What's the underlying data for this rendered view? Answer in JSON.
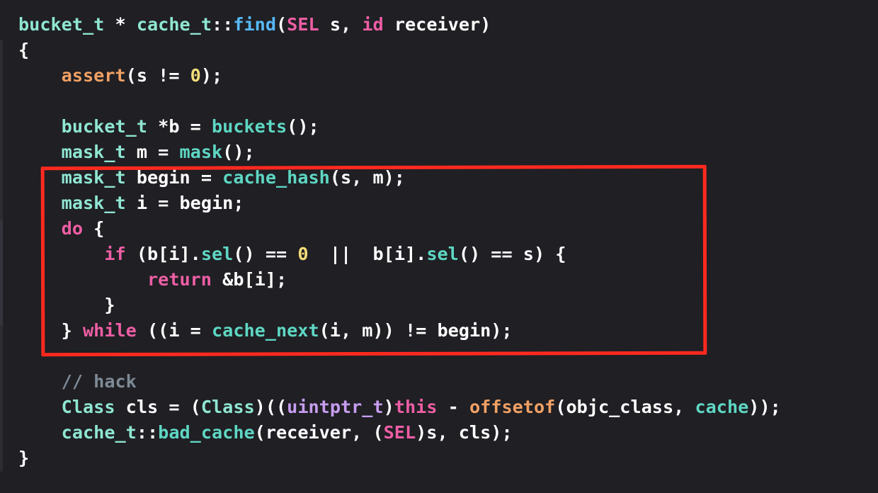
{
  "code": {
    "lines": [
      [
        {
          "t": "bucket_t",
          "c": "ty"
        },
        {
          "t": " * ",
          "c": "pl"
        },
        {
          "t": "cache_t",
          "c": "ty"
        },
        {
          "t": "::",
          "c": "pl"
        },
        {
          "t": "find",
          "c": "blue"
        },
        {
          "t": "(",
          "c": "pl"
        },
        {
          "t": "SEL",
          "c": "kw"
        },
        {
          "t": " s, ",
          "c": "pl"
        },
        {
          "t": "id",
          "c": "kw"
        },
        {
          "t": " receiver)",
          "c": "pl"
        }
      ],
      [
        {
          "t": "{",
          "c": "pl"
        }
      ],
      [
        {
          "t": "    ",
          "c": "pl"
        },
        {
          "t": "assert",
          "c": "mac"
        },
        {
          "t": "(s != ",
          "c": "pl"
        },
        {
          "t": "0",
          "c": "num"
        },
        {
          "t": ");",
          "c": "pl"
        }
      ],
      [
        {
          "t": "",
          "c": "pl"
        }
      ],
      [
        {
          "t": "    ",
          "c": "pl"
        },
        {
          "t": "bucket_t",
          "c": "ty"
        },
        {
          "t": " *b = ",
          "c": "pl"
        },
        {
          "t": "buckets",
          "c": "fn"
        },
        {
          "t": "();",
          "c": "pl"
        }
      ],
      [
        {
          "t": "    ",
          "c": "pl"
        },
        {
          "t": "mask_t",
          "c": "ty"
        },
        {
          "t": " m = ",
          "c": "pl"
        },
        {
          "t": "mask",
          "c": "fn"
        },
        {
          "t": "();",
          "c": "pl"
        }
      ],
      [
        {
          "t": "    ",
          "c": "pl"
        },
        {
          "t": "mask_t",
          "c": "ty"
        },
        {
          "t": " begin = ",
          "c": "pl"
        },
        {
          "t": "cache_hash",
          "c": "fn"
        },
        {
          "t": "(s, m);",
          "c": "pl"
        }
      ],
      [
        {
          "t": "    ",
          "c": "pl"
        },
        {
          "t": "mask_t",
          "c": "ty"
        },
        {
          "t": " i = begin;",
          "c": "pl"
        }
      ],
      [
        {
          "t": "    ",
          "c": "pl"
        },
        {
          "t": "do",
          "c": "kw"
        },
        {
          "t": " {",
          "c": "pl"
        }
      ],
      [
        {
          "t": "        ",
          "c": "pl"
        },
        {
          "t": "if",
          "c": "kw"
        },
        {
          "t": " (b[i].",
          "c": "pl"
        },
        {
          "t": "sel",
          "c": "fn"
        },
        {
          "t": "() == ",
          "c": "pl"
        },
        {
          "t": "0",
          "c": "num"
        },
        {
          "t": "  ||  b[i].",
          "c": "pl"
        },
        {
          "t": "sel",
          "c": "fn"
        },
        {
          "t": "() == s) {",
          "c": "pl"
        }
      ],
      [
        {
          "t": "            ",
          "c": "pl"
        },
        {
          "t": "return",
          "c": "kw"
        },
        {
          "t": " &b[i];",
          "c": "pl"
        }
      ],
      [
        {
          "t": "        }",
          "c": "pl"
        }
      ],
      [
        {
          "t": "    } ",
          "c": "pl"
        },
        {
          "t": "while",
          "c": "kw"
        },
        {
          "t": " ((i = ",
          "c": "pl"
        },
        {
          "t": "cache_next",
          "c": "fn"
        },
        {
          "t": "(i, m)) != begin);",
          "c": "pl"
        }
      ],
      [
        {
          "t": "",
          "c": "pl"
        }
      ],
      [
        {
          "t": "    ",
          "c": "pl"
        },
        {
          "t": "// hack",
          "c": "com"
        }
      ],
      [
        {
          "t": "    ",
          "c": "pl"
        },
        {
          "t": "Class",
          "c": "ty"
        },
        {
          "t": " cls = (",
          "c": "pl"
        },
        {
          "t": "Class",
          "c": "ty"
        },
        {
          "t": ")((",
          "c": "pl"
        },
        {
          "t": "uintptr_t",
          "c": "kwp"
        },
        {
          "t": ")",
          "c": "pl"
        },
        {
          "t": "this",
          "c": "kw"
        },
        {
          "t": " - ",
          "c": "pl"
        },
        {
          "t": "offsetof",
          "c": "mac"
        },
        {
          "t": "(objc_class, ",
          "c": "pl"
        },
        {
          "t": "cache",
          "c": "fn"
        },
        {
          "t": "));",
          "c": "pl"
        }
      ],
      [
        {
          "t": "    ",
          "c": "pl"
        },
        {
          "t": "cache_t",
          "c": "ty"
        },
        {
          "t": "::",
          "c": "pl"
        },
        {
          "t": "bad_cache",
          "c": "fn"
        },
        {
          "t": "(receiver, (",
          "c": "pl"
        },
        {
          "t": "SEL",
          "c": "kw"
        },
        {
          "t": ")s, cls);",
          "c": "pl"
        }
      ],
      [
        {
          "t": "}",
          "c": "pl"
        }
      ]
    ]
  },
  "colors": {
    "background": "#1f1f24",
    "highlight_box": "#ff2a1f"
  }
}
